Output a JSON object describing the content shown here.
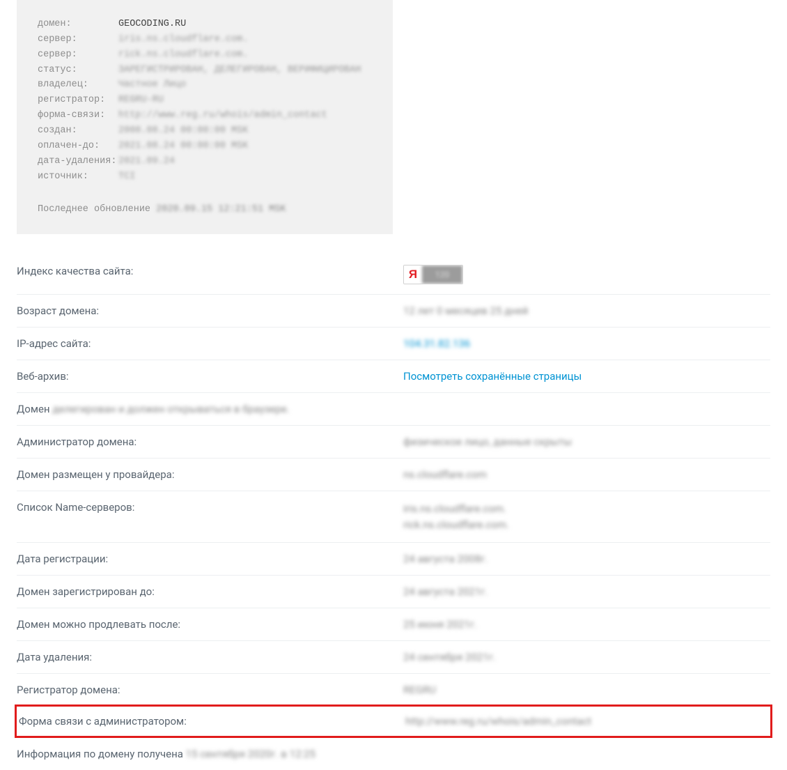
{
  "whois": {
    "lines": [
      {
        "key": "домен:",
        "value": "GEOCODING.RU",
        "clear": true
      },
      {
        "key": "сервер:",
        "value": "iris.ns.cloudflare.com."
      },
      {
        "key": "сервер:",
        "value": "rick.ns.cloudflare.com."
      },
      {
        "key": "статус:",
        "value": "ЗАРЕГИСТРИРОВАН, ДЕЛЕГИРОВАН, ВЕРИФИЦИРОВАН"
      },
      {
        "key": "владелец:",
        "value": "Частное Лицо"
      },
      {
        "key": "регистратор:",
        "value": "REGRU-RU"
      },
      {
        "key": "форма-связи:",
        "value": "http://www.reg.ru/whois/admin_contact"
      },
      {
        "key": "создан:",
        "value": "2008.08.24 00:00:00 MSK"
      },
      {
        "key": "оплачен-до:",
        "value": "2021.08.24 00:00:00 MSK"
      },
      {
        "key": "дата-удаления:",
        "value": "2021.09.24"
      },
      {
        "key": "источник:",
        "value": "TCI"
      }
    ],
    "last_update_label": "Последнее обновление",
    "last_update_value": "2020.09.15 12:21:51 MSK"
  },
  "rows": {
    "quality_index_label": "Индекс качества сайта:",
    "ya_letter": "Я",
    "ya_value": "120",
    "age_label": "Возраст домена:",
    "age_value": "12 лет 0 месяцев 25 дней",
    "ip_label": "IP-адрес сайта:",
    "ip_value": "104.31.82.136",
    "webarchive_label": "Веб-архив:",
    "webarchive_link": "Посмотреть сохранённые страницы",
    "domain_prefix": "Домен",
    "domain_status_text": "делегирован и должен открываться в браузере.",
    "admin_label": "Администратор домена:",
    "admin_value": "физическое лицо, данные скрыты",
    "provider_label": "Домен размещен у провайдера:",
    "provider_value": "ns.cloudflare.com",
    "ns_label": "Список Name-серверов:",
    "ns1": "iris.ns.cloudflare.com.",
    "ns2": "rick.ns.cloudflare.com.",
    "reg_date_label": "Дата регистрации:",
    "reg_date_value": "24 августа 2008г.",
    "reg_until_label": "Домен зарегистрирован до:",
    "reg_until_value": "24 августа 2021г.",
    "renew_after_label": "Домен можно продлевать после:",
    "renew_after_value": "25 июня 2021г.",
    "delete_date_label": "Дата удаления:",
    "delete_date_value": "24 сентября 2021г.",
    "registrar_label": "Регистратор домена:",
    "registrar_value": "REGRU",
    "contact_form_label": "Форма связи с администратором:",
    "contact_form_value": "http://www.reg.ru/whois/admin_contact",
    "info_received_prefix": "Информация по домену получена",
    "info_received_value": "15 сентября 2020г. в 12:25"
  }
}
